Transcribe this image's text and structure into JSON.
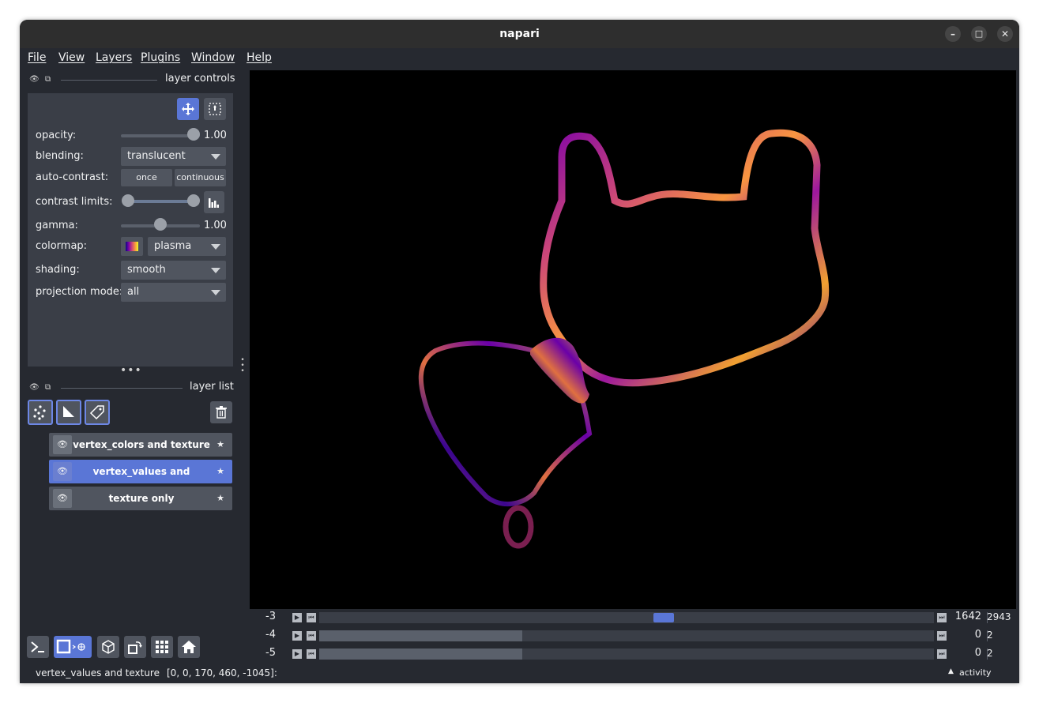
{
  "window": {
    "title": "napari"
  },
  "window_controls": {
    "minimize": "–",
    "maximize": "□",
    "close": "✕"
  },
  "menu": [
    "File",
    "View",
    "Layers",
    "Plugins",
    "Window",
    "Help"
  ],
  "layer_controls": {
    "title": "layer controls",
    "opacity_label": "opacity:",
    "opacity_value": "1.00",
    "opacity_fraction": 1.0,
    "blending_label": "blending:",
    "blending_value": "translucent",
    "auto_contrast_label": "auto-contrast:",
    "once_label": "once",
    "continuous_label": "continuous",
    "contrast_limits_label": "contrast limits:",
    "gamma_label": "gamma:",
    "gamma_value": "1.00",
    "gamma_fraction": 0.5,
    "colormap_label": "colormap:",
    "colormap_value": "plasma",
    "shading_label": "shading:",
    "shading_value": "smooth",
    "projection_label": "projection mode:",
    "projection_value": "all"
  },
  "layer_list": {
    "title": "layer list",
    "layers": [
      {
        "name": "vertex_colors and texture",
        "selected": false
      },
      {
        "name": "vertex_values and texture",
        "selected": true
      },
      {
        "name": "texture only",
        "selected": false
      }
    ]
  },
  "dims": [
    {
      "label": "-3",
      "current": "1642",
      "max": "2943",
      "fraction": 0.56
    },
    {
      "label": "-4",
      "current": "0",
      "max": "2",
      "fraction": 0.33
    },
    {
      "label": "-5",
      "current": "0",
      "max": "2",
      "fraction": 0.33
    }
  ],
  "status": {
    "layer_name": "vertex_values and texture",
    "coords": "[0, 0, 170, 460, -1045]:",
    "activity": "activity"
  },
  "colors": {
    "accent": "#5a76d6",
    "background": "#262930",
    "panel": "#3a3e47",
    "canvas": "#000000"
  },
  "icons": {
    "pan_zoom": "move-arrows-icon",
    "transform": "transform-icon",
    "points": "new-points-icon",
    "shapes": "new-shapes-icon",
    "labels": "new-labels-icon",
    "delete": "trash-icon",
    "console": "console-icon",
    "ndisplay": "2d-3d-toggle-icon",
    "roll": "roll-axes-icon",
    "transpose": "transpose-icon",
    "grid": "grid-icon",
    "home": "home-icon"
  }
}
